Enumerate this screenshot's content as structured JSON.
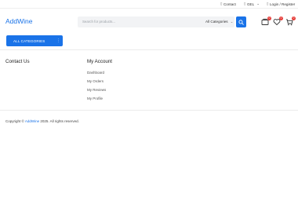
{
  "topbar": {
    "contact": "Contact",
    "currency": "GEL",
    "login": "Login / Register"
  },
  "header": {
    "logo": "AddWine",
    "search_placeholder": "Search for products...",
    "category": "All Categories",
    "badges": {
      "compare": "0",
      "wishlist": "0",
      "cart": "0"
    }
  },
  "nav": {
    "all_categories": "ALL CATEGORIES"
  },
  "footer": {
    "contact_title": "Contact Us",
    "account_title": "My Account",
    "account_links": [
      "Dashboard",
      "My Orders",
      "My Reviews",
      "My Profile"
    ],
    "copyright_prefix": "Copyright ©",
    "copyright_brand": "AddWine",
    "copyright_suffix": "2025. All rights reserved."
  },
  "colors": {
    "accent": "#1a73e8",
    "badge": "#e53935"
  }
}
